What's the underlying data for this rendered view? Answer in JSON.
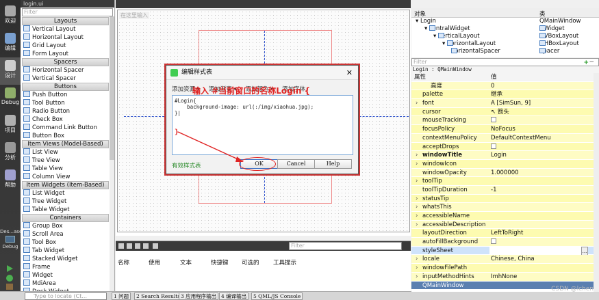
{
  "mode_bar": [
    {
      "label": "欢迎",
      "icon": "welcome-icon",
      "color": "#a8a8a8"
    },
    {
      "label": "编辑",
      "icon": "edit-icon",
      "color": "#7aa0d0"
    },
    {
      "label": "设计",
      "icon": "design-icon",
      "color": "#cfcfcf"
    },
    {
      "label": "Debug",
      "icon": "debug-icon",
      "color": "#8fae6a"
    },
    {
      "label": "项目",
      "icon": "project-icon",
      "color": "#b0b0b0"
    },
    {
      "label": "分析",
      "icon": "analyze-icon",
      "color": "#999999"
    },
    {
      "label": "帮助",
      "icon": "help-icon",
      "color": "#a0a0d0"
    }
  ],
  "kit_label": "Des...ase",
  "kit_label2": "Debug",
  "file_tab": "login.ui",
  "widget_box": {
    "filter_placeholder": "Filter",
    "groups": [
      {
        "title": "Layouts",
        "items": [
          "Vertical Layout",
          "Horizontal Layout",
          "Grid Layout",
          "Form Layout"
        ]
      },
      {
        "title": "Spacers",
        "items": [
          "Horizontal Spacer",
          "Vertical Spacer"
        ]
      },
      {
        "title": "Buttons",
        "items": [
          "Push Button",
          "Tool Button",
          "Radio Button",
          "Check Box",
          "Command Link Button",
          "Button Box"
        ]
      },
      {
        "title": "Item Views (Model-Based)",
        "items": [
          "List View",
          "Tree View",
          "Table View",
          "Column View"
        ]
      },
      {
        "title": "Item Widgets (Item-Based)",
        "items": [
          "List Widget",
          "Tree Widget",
          "Table Widget"
        ]
      },
      {
        "title": "Containers",
        "items": [
          "Group Box",
          "Scroll Area",
          "Tool Box",
          "Tab Widget",
          "Stacked Widget",
          "Frame",
          "Widget",
          "MdiArea",
          "Dock Widget"
        ]
      }
    ]
  },
  "canvas": {
    "menu_hint": "在这里输入"
  },
  "dialog": {
    "title": "编辑样式表",
    "toolbar": [
      "添加资源 ▾",
      "添加渐变 ▾",
      "添加颜色 ▾",
      "添加字体"
    ],
    "code_lines": [
      "#Login{",
      "    background-image: url(:/img/xiaohua.jpg);",
      "}|",
      "",
      "",
      "}"
    ],
    "valid_text": "有效样式表",
    "ok": "OK",
    "cancel": "Cancel",
    "help": "Help",
    "annotation": "输入 #当前窗口的名称Login {"
  },
  "action_editor": {
    "filter_placeholder": "Filter",
    "columns": [
      "名称",
      "使用",
      "文本",
      "快捷键",
      "可选的",
      "工具提示"
    ]
  },
  "status_bar": {
    "locate_placeholder": "Type to locate (Ct...",
    "panes": [
      "1 问题",
      "2 Search Results",
      "3 应用程序输出",
      "4 编译输出",
      "5 QML/JS Console"
    ]
  },
  "object_inspector": {
    "header_object": "对象",
    "header_class": "类",
    "rows": [
      {
        "name": "Login",
        "class": "QMainWindow",
        "indent": 0
      },
      {
        "name": "centralWidget",
        "class": "QWidget",
        "indent": 1
      },
      {
        "name": "verticalLayout",
        "class": "QVBoxLayout",
        "indent": 2
      },
      {
        "name": "horizontalLayout",
        "class": "QHBoxLayout",
        "indent": 3
      },
      {
        "name": "horizontalSpacer",
        "class": "Spacer",
        "indent": 4
      }
    ]
  },
  "property_editor": {
    "filter_placeholder": "Filter",
    "context": "Login : QMainWindow",
    "header_prop": "属性",
    "header_value": "值",
    "rows": [
      {
        "k": "高度",
        "v": "0",
        "shade": "y1",
        "indent": 1
      },
      {
        "k": "palette",
        "v": "继承",
        "shade": "y2"
      },
      {
        "k": "font",
        "v": "A  [SimSun, 9]",
        "shade": "y1",
        "exp": true
      },
      {
        "k": "cursor",
        "v": "↖ 箭头",
        "shade": "y2"
      },
      {
        "k": "mouseTracking",
        "v": "",
        "shade": "y1",
        "check": true
      },
      {
        "k": "focusPolicy",
        "v": "NoFocus",
        "shade": "y2"
      },
      {
        "k": "contextMenuPolicy",
        "v": "DefaultContextMenu",
        "shade": "y1"
      },
      {
        "k": "acceptDrops",
        "v": "",
        "shade": "y2",
        "check": true
      },
      {
        "k": "windowTitle",
        "v": "Login",
        "shade": "y1",
        "exp": true,
        "bold": true
      },
      {
        "k": "windowIcon",
        "v": "",
        "shade": "y2",
        "exp": true
      },
      {
        "k": "windowOpacity",
        "v": "1.000000",
        "shade": "y1"
      },
      {
        "k": "toolTip",
        "v": "",
        "shade": "y2",
        "exp": true
      },
      {
        "k": "toolTipDuration",
        "v": "-1",
        "shade": "y1"
      },
      {
        "k": "statusTip",
        "v": "",
        "shade": "y2",
        "exp": true
      },
      {
        "k": "whatsThis",
        "v": "",
        "shade": "y1",
        "exp": true
      },
      {
        "k": "accessibleName",
        "v": "",
        "shade": "y2",
        "exp": true
      },
      {
        "k": "accessibleDescription",
        "v": "",
        "shade": "y1",
        "exp": true
      },
      {
        "k": "layoutDirection",
        "v": "LeftToRight",
        "shade": "y2"
      },
      {
        "k": "autoFillBackground",
        "v": "",
        "shade": "y1",
        "check": true
      },
      {
        "k": "styleSheet",
        "v": "",
        "shade": "sel",
        "red": true
      },
      {
        "k": "locale",
        "v": "Chinese, China",
        "shade": "y1",
        "exp": true
      },
      {
        "k": "windowFilePath",
        "v": "",
        "shade": "y2",
        "exp": true
      },
      {
        "k": "inputMethodHints",
        "v": "ImhNone",
        "shade": "y1",
        "exp": true
      },
      {
        "k": "QMainWindow",
        "v": "",
        "shade": "section"
      }
    ]
  },
  "watermark": "CSDN @lchen"
}
